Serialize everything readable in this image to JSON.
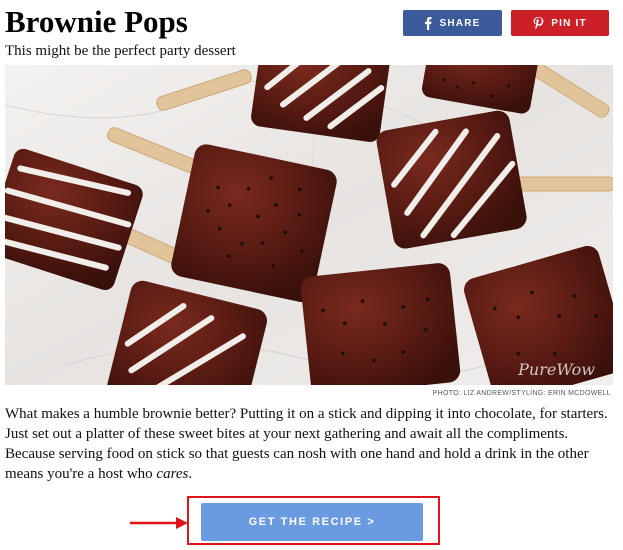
{
  "header": {
    "title": "Brownie Pops",
    "subtitle": "This might be the perfect party dessert"
  },
  "social": {
    "share_label": "SHARE",
    "share_icon": "facebook-icon",
    "pin_label": "PIN IT",
    "pin_icon": "pinterest-icon",
    "share_color": "#3b5a9a",
    "pin_color": "#cb2027"
  },
  "photo": {
    "credit": "PHOTO: LIZ ANDREW/STYLING: ERIN MCDOWELL",
    "watermark": "PureWow"
  },
  "article": {
    "text_before": "What makes a humble brownie better? Putting it on a stick and dipping it into chocolate, for starters. Just set out a platter of these sweet bites at your next gathering and await all the compliments. Because serving food on stick so that guests can nosh with one hand and hold a drink in the other means you're a host who ",
    "text_emphasis": "cares",
    "text_after": "."
  },
  "cta": {
    "label": "GET THE RECIPE >",
    "button_color": "#6a9ae0",
    "highlight_color": "#e0141b"
  }
}
